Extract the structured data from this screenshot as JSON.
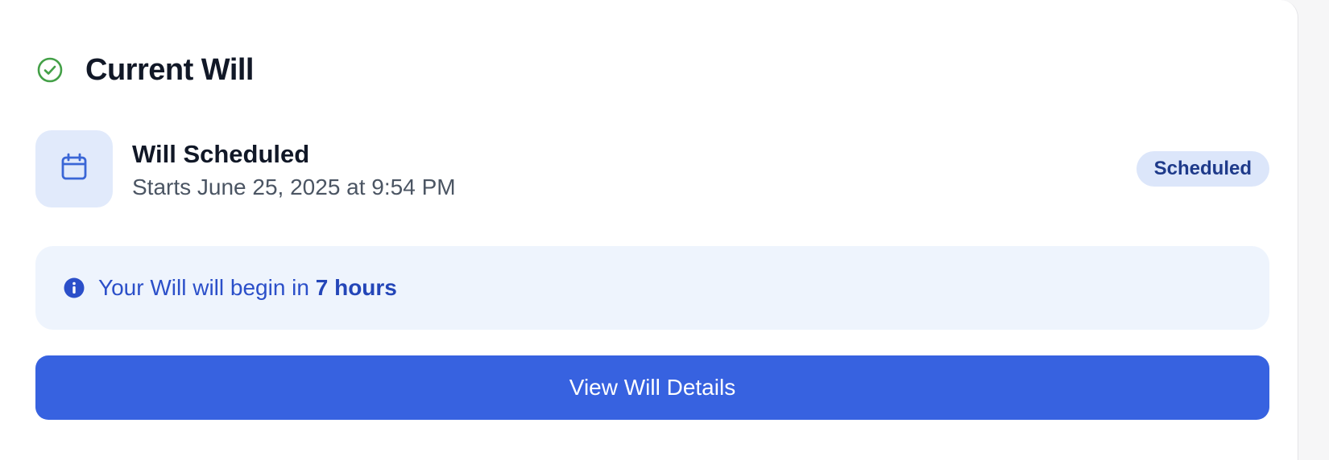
{
  "header": {
    "title": "Current Will",
    "icon": "check-circle-icon",
    "icon_color": "#43a047"
  },
  "schedule": {
    "icon": "calendar-icon",
    "icon_color": "#3a66d6",
    "title": "Will Scheduled",
    "subtitle": "Starts June 25, 2025 at 9:54 PM",
    "status_badge": "Scheduled"
  },
  "info": {
    "icon": "info-icon",
    "text_prefix": "Your Will will begin in ",
    "text_emphasis": "7 hours"
  },
  "actions": {
    "view_details_label": "View Will Details",
    "accent_color": "#3762e0"
  }
}
